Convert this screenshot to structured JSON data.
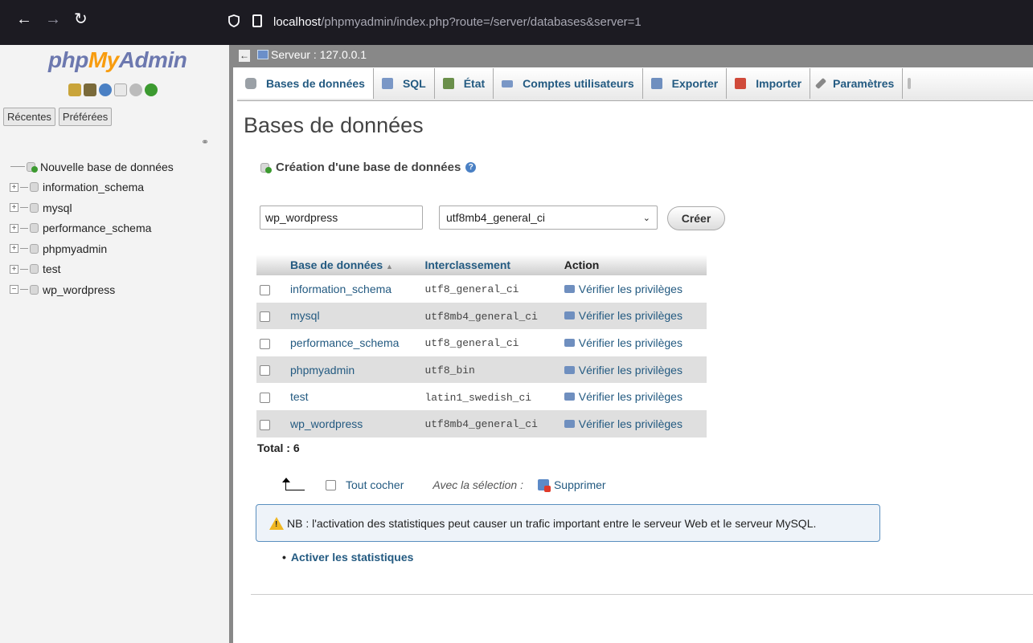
{
  "browser": {
    "url_host": "localhost",
    "url_path": "/phpmyadmin/index.php?route=/server/databases&server=1"
  },
  "sidebar": {
    "logo_php": "php",
    "logo_my": "My",
    "logo_admin": "Admin",
    "recent_label": "Récentes",
    "favorites_label": "Préférées",
    "new_db_label": "Nouvelle base de données",
    "databases": [
      "information_schema",
      "mysql",
      "performance_schema",
      "phpmyadmin",
      "test",
      "wp_wordpress"
    ]
  },
  "server_bar": {
    "label": "Serveur : 127.0.0.1"
  },
  "tabs": [
    {
      "label": "Bases de données",
      "icon": "database-icon",
      "color": "#9aa0a6"
    },
    {
      "label": "SQL",
      "icon": "sql-icon",
      "color": "#7a97c6"
    },
    {
      "label": "État",
      "icon": "status-icon",
      "color": "#6a8f4a"
    },
    {
      "label": "Comptes utilisateurs",
      "icon": "users-icon",
      "color": "#7a97c6"
    },
    {
      "label": "Exporter",
      "icon": "export-icon",
      "color": "#6f8fbf"
    },
    {
      "label": "Importer",
      "icon": "import-icon",
      "color": "#d04a3a"
    },
    {
      "label": "Paramètres",
      "icon": "wrench-icon",
      "color": "#888888"
    }
  ],
  "main": {
    "title": "Bases de données",
    "create_heading": "Création d'une base de données",
    "db_name_value": "wp_wordpress",
    "collation_value": "utf8mb4_general_ci",
    "create_button": "Créer",
    "table_headers": {
      "name": "Base de données",
      "collation": "Interclassement",
      "action": "Action"
    },
    "rows": [
      {
        "name": "information_schema",
        "collation": "utf8_general_ci",
        "action": "Vérifier les privilèges"
      },
      {
        "name": "mysql",
        "collation": "utf8mb4_general_ci",
        "action": "Vérifier les privilèges"
      },
      {
        "name": "performance_schema",
        "collation": "utf8_general_ci",
        "action": "Vérifier les privilèges"
      },
      {
        "name": "phpmyadmin",
        "collation": "utf8_bin",
        "action": "Vérifier les privilèges"
      },
      {
        "name": "test",
        "collation": "latin1_swedish_ci",
        "action": "Vérifier les privilèges"
      },
      {
        "name": "wp_wordpress",
        "collation": "utf8mb4_general_ci",
        "action": "Vérifier les privilèges"
      }
    ],
    "total": "Total : 6",
    "check_all": "Tout cocher",
    "with_selection": "Avec la sélection :",
    "delete_label": "Supprimer",
    "notice": "NB : l'activation des statistiques peut causer un trafic important entre le serveur Web et le serveur MySQL.",
    "enable_stats": "Activer les statistiques"
  },
  "colors": {
    "link": "#235a81",
    "logo_blue": "#6c78af",
    "logo_orange": "#f89c0e"
  }
}
